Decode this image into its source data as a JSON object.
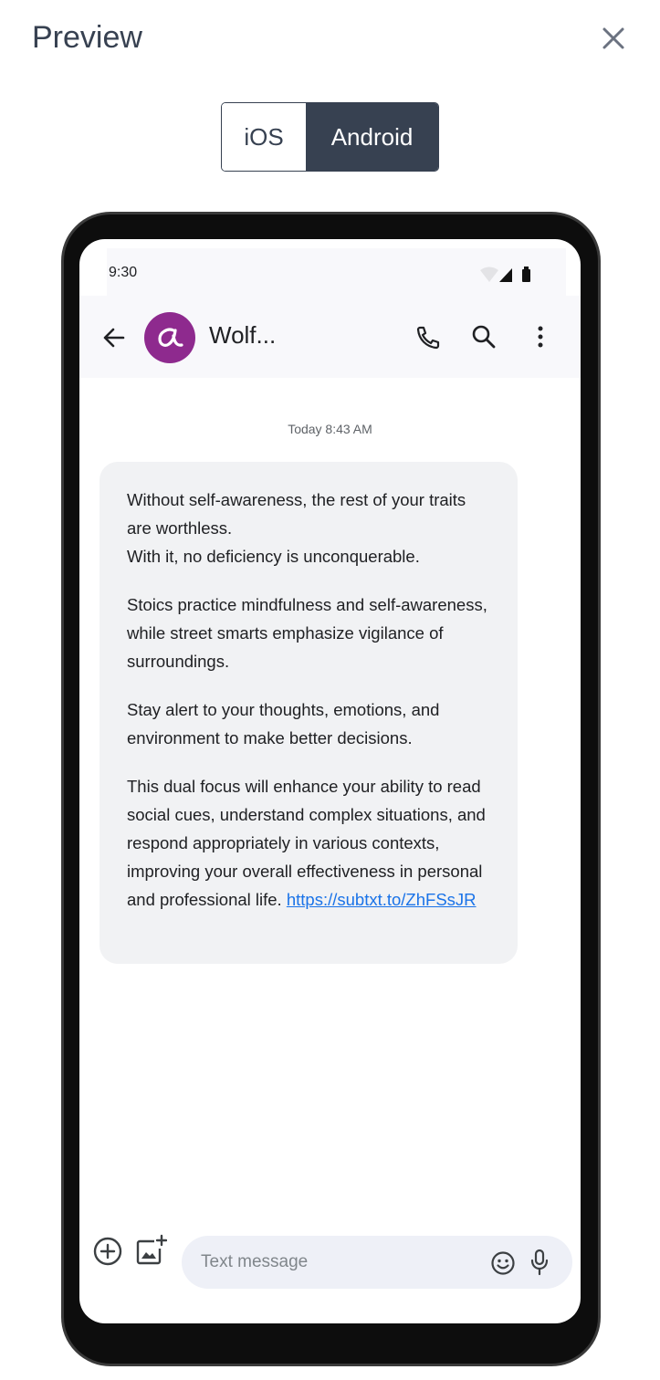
{
  "header": {
    "title": "Preview",
    "close_icon": "close-icon"
  },
  "platform_toggle": {
    "options": [
      "iOS",
      "Android"
    ],
    "selected": "Android"
  },
  "colors": {
    "toggle_active": "#374151",
    "avatar": "#8e2a8e",
    "bubble": "#f1f2f4",
    "link": "#1a73e8"
  },
  "phone": {
    "status_bar": {
      "time": "9:30",
      "icons": [
        "wifi-icon",
        "signal-icon",
        "battery-icon"
      ]
    },
    "app_bar": {
      "contact_name": "Wolf...",
      "avatar_icon": "alpha-logo-icon",
      "actions": [
        "phone-icon",
        "search-icon",
        "more-vert-icon"
      ]
    },
    "conversation": {
      "timestamp": "Today 8:43 AM",
      "message": {
        "paragraphs": [
          "Without self-awareness, the rest of your traits are worthless.\nWith it, no deficiency is unconquerable.",
          "Stoics practice mindfulness and self-awareness, while street smarts emphasize vigilance of surroundings.",
          "Stay alert to your thoughts, emotions, and environment to make better decisions.",
          "This dual focus will enhance your ability to read social cues, understand complex situations, and respond appropriately in various contexts, improving your overall effectiveness in personal and professional life."
        ],
        "link": "https://subtxt.to/ZhFSsJR"
      }
    },
    "composer": {
      "placeholder": "Text message",
      "value": ""
    }
  }
}
